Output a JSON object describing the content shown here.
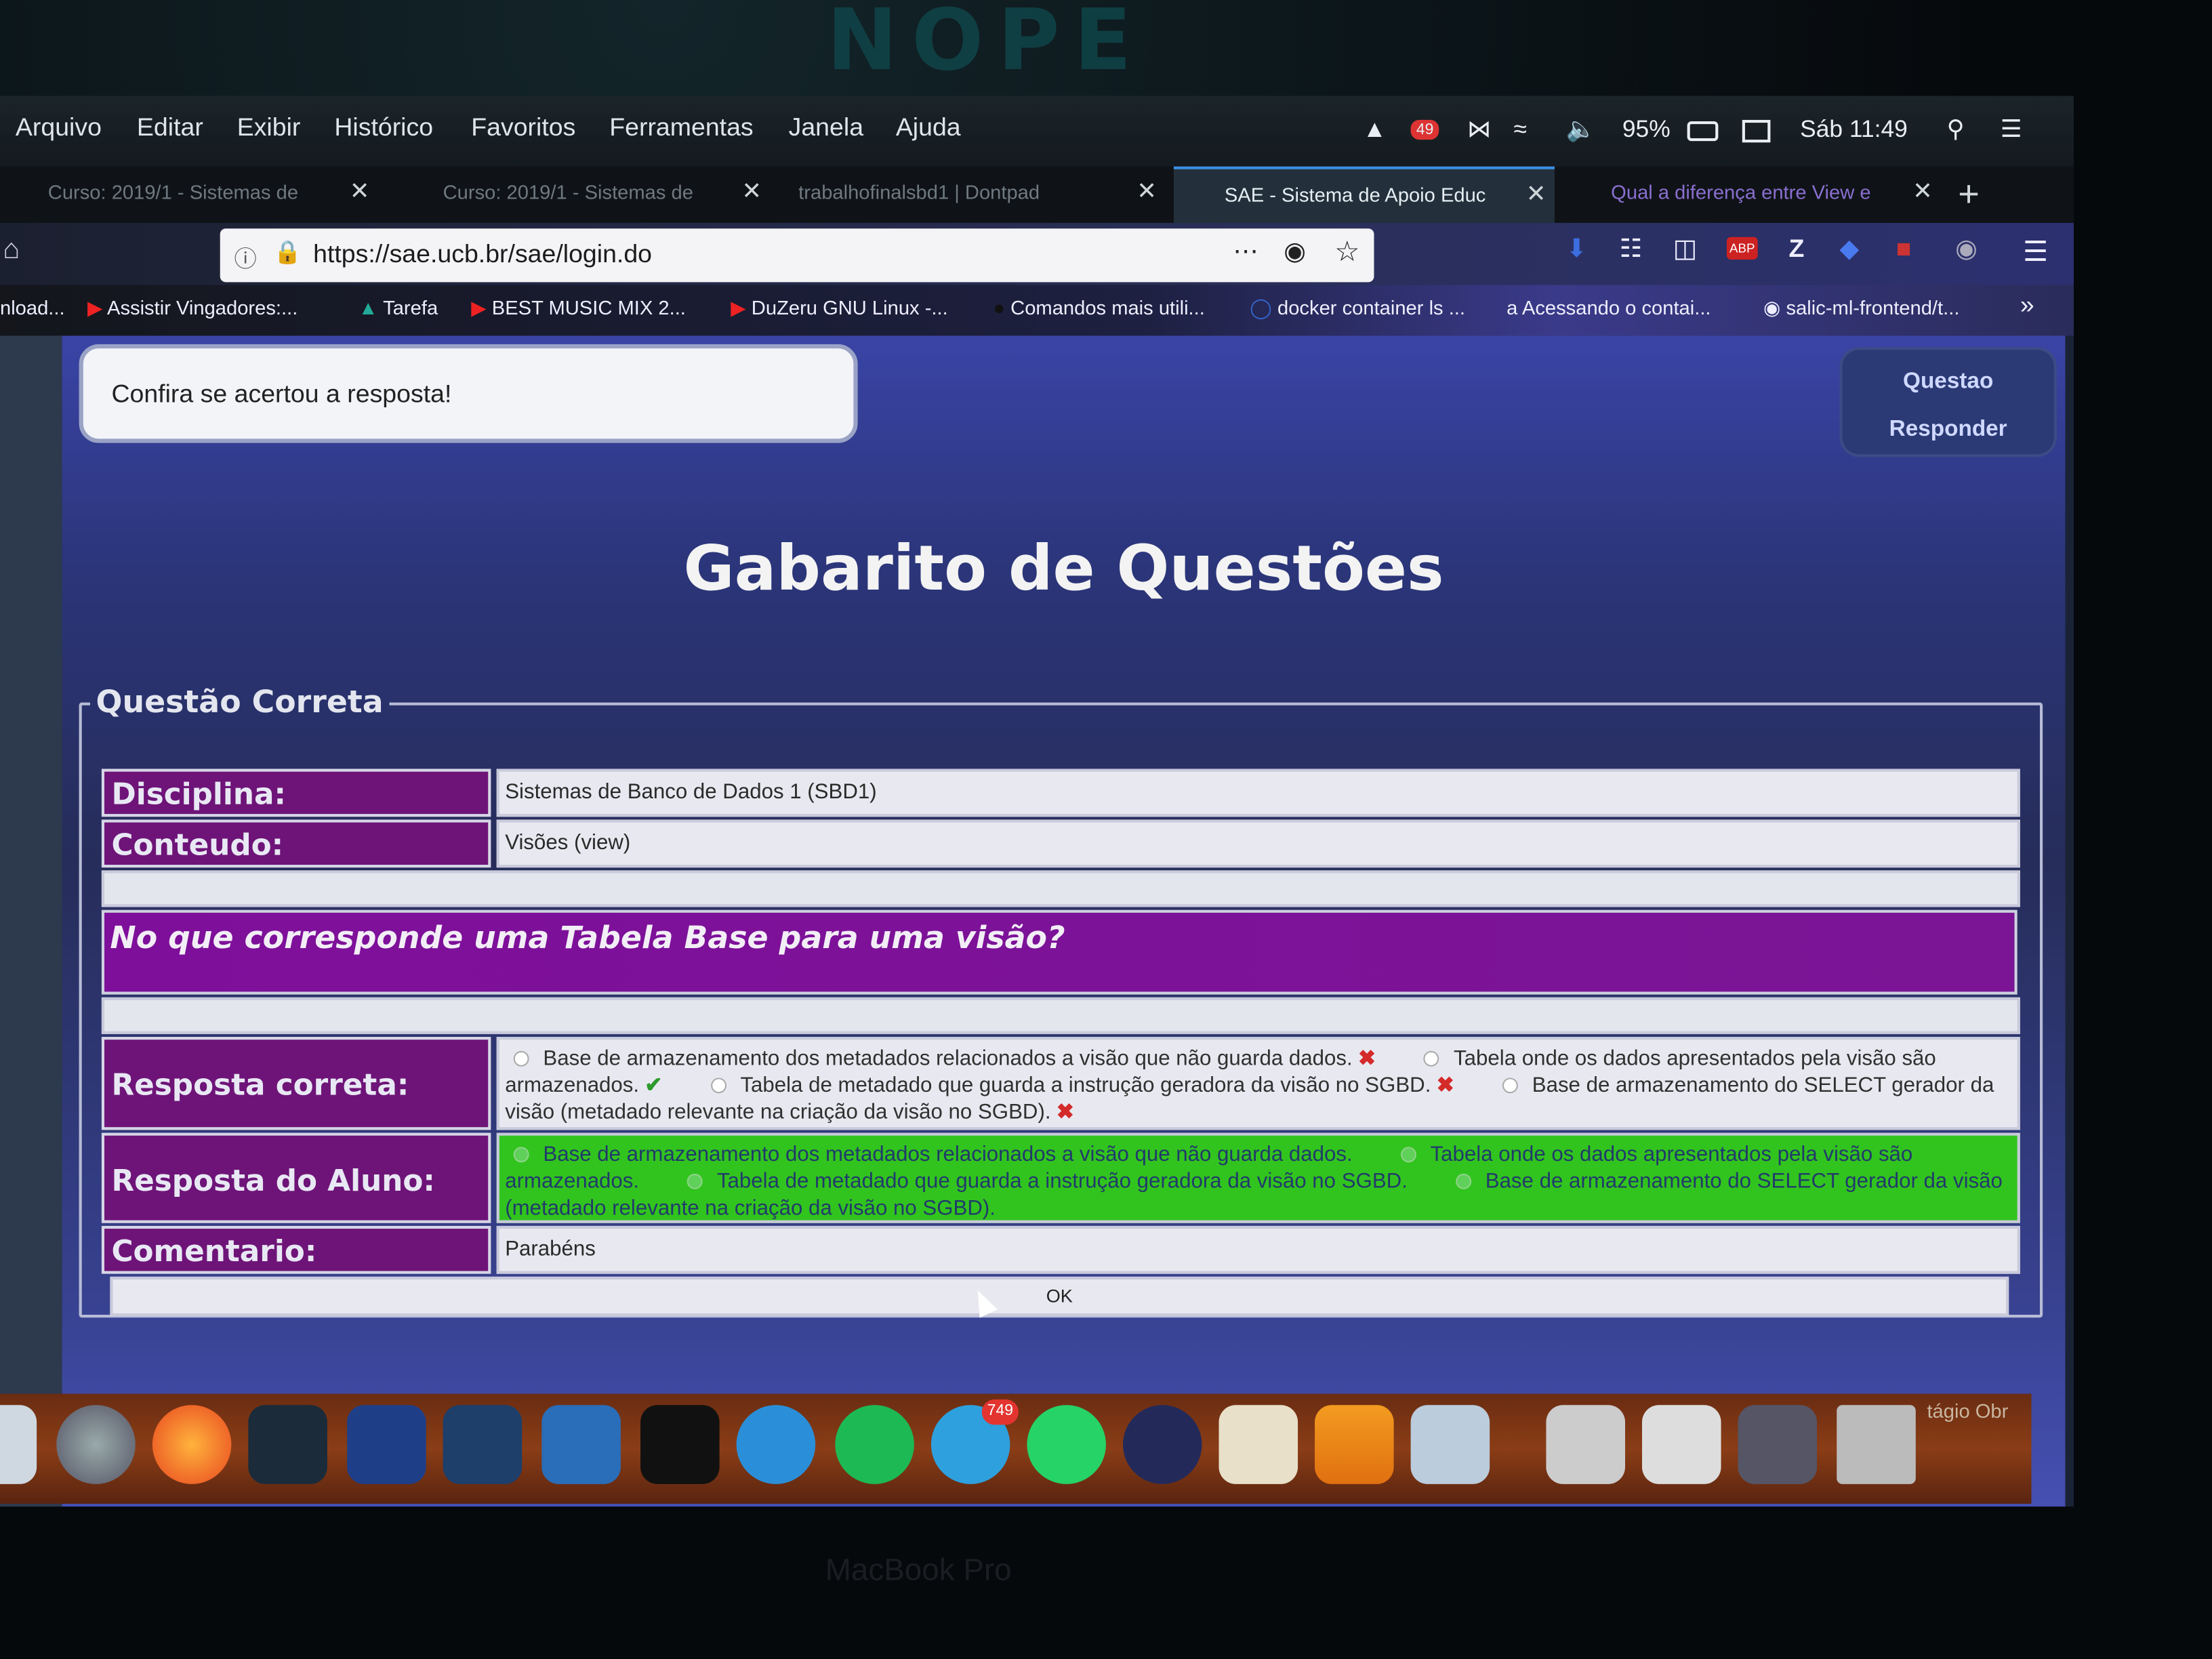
{
  "bezel": {
    "logo_text": "NOPE",
    "device_label": "MacBook Pro"
  },
  "menubar": {
    "items": [
      "Arquivo",
      "Editar",
      "Exibir",
      "Histórico",
      "Favoritos",
      "Ferramentas",
      "Janela",
      "Ajuda"
    ],
    "tray_badge": "49",
    "battery": "95%",
    "clock": "Sáb 11:49"
  },
  "tabs": [
    {
      "label": "Curso: 2019/1 - Sistemas de"
    },
    {
      "label": "Curso: 2019/1 - Sistemas de"
    },
    {
      "label": "trabalhofinalsbd1 | Dontpad"
    },
    {
      "label": "SAE - Sistema de Apoio Educ"
    },
    {
      "label": "Qual a diferença entre View e"
    }
  ],
  "address_bar": {
    "url": "https://sae.ucb.br/sae/login.do"
  },
  "bookmarks": [
    "nload...",
    "Assistir Vingadores:...",
    "Tarefa",
    "BEST MUSIC MIX 2...",
    "DuZeru GNU Linux -...",
    "Comandos mais utili...",
    "docker container ls ...",
    "Acessando o contai...",
    "salic-ml-frontend/t..."
  ],
  "page": {
    "message": "Confira se acertou a resposta!",
    "side_panel": {
      "link1": "Questao",
      "link2": "Responder"
    },
    "title": "Gabarito de Questões",
    "section_title": "Questão Correta",
    "labels": {
      "disciplina": "Disciplina:",
      "conteudo": "Conteudo:",
      "resposta_correta": "Resposta correta:",
      "resposta_aluno": "Resposta do Aluno:",
      "comentario": "Comentario:"
    },
    "disciplina": "Sistemas de Banco de Dados 1 (SBD1)",
    "conteudo": "Visões (view)",
    "question": "No que corresponde uma Tabela Base para uma visão?",
    "options": [
      "Base de armazenamento dos metadados relacionados a visão que não guarda dados.",
      "Tabela onde os dados apresentados pela visão são armazenados.",
      "Tabela de metadado que guarda a instrução geradora da visão no SGBD.",
      "Base de armazenamento do SELECT gerador da visão (metadado relevante na criação da visão no SGBD)."
    ],
    "correct_index": 1,
    "student_index": 1,
    "comentario": "Parabéns",
    "ok_label": "OK"
  },
  "dock": {
    "telegram_badge": "749",
    "trailing_text": "tágio Obr"
  }
}
